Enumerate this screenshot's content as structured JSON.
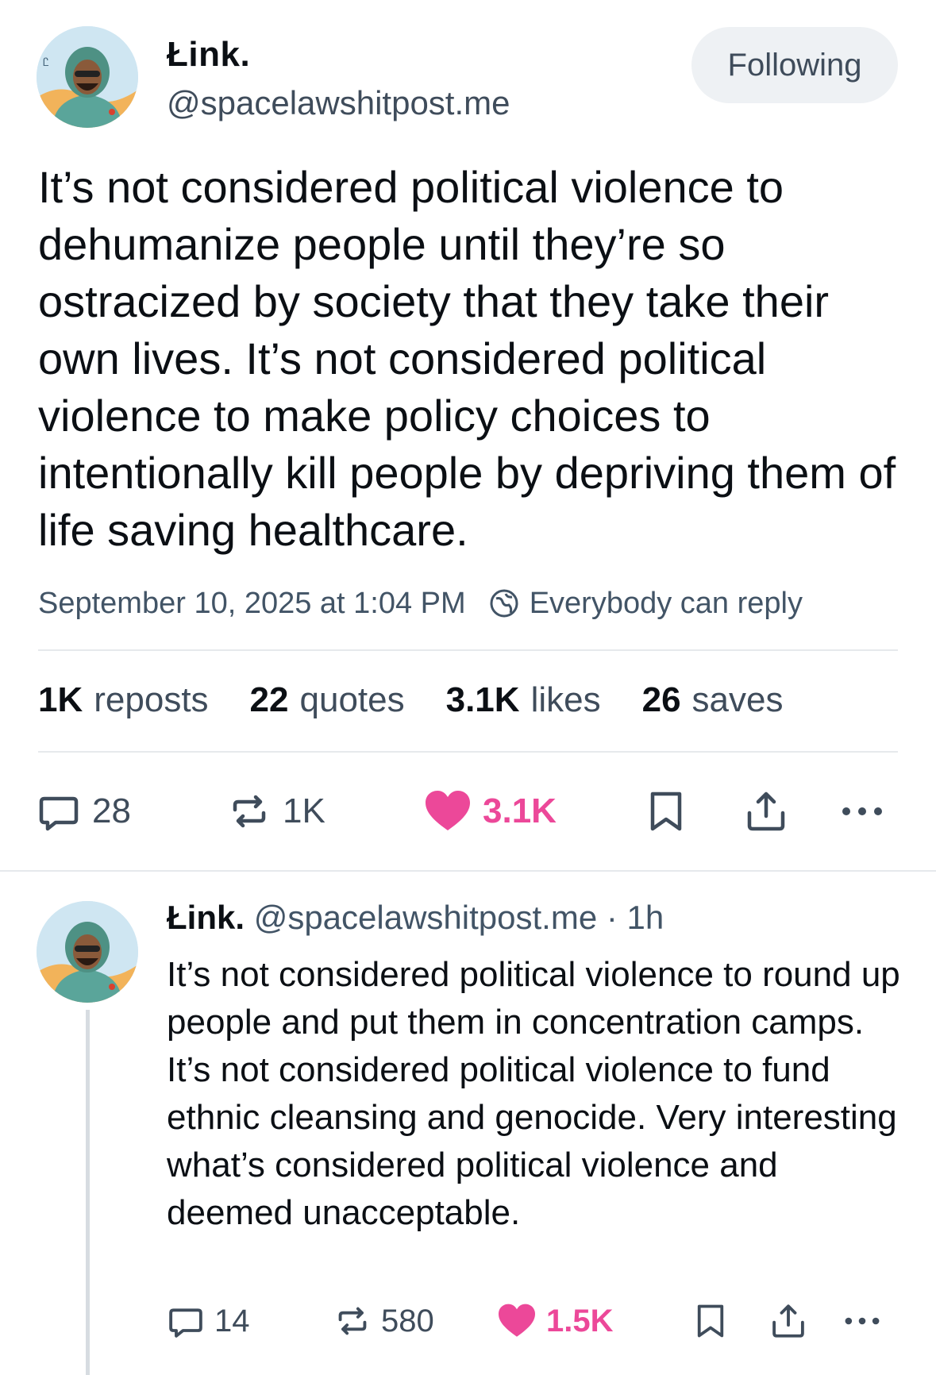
{
  "main_post": {
    "author_name": "Łink.",
    "author_handle": "@spacelawshitpost.me",
    "follow_button_label": "Following",
    "text": "It’s not considered political violence to dehumanize people until they’re so ostracized by society that they take their own lives. It’s not considered political violence to make policy choices to intentionally kill people by depriving them of life saving healthcare.",
    "timestamp": "September 10, 2025 at 1:04 PM",
    "reply_setting": "Everybody can reply",
    "stats": {
      "reposts": {
        "count": "1K",
        "label": "reposts"
      },
      "quotes": {
        "count": "22",
        "label": "quotes"
      },
      "likes": {
        "count": "3.1K",
        "label": "likes"
      },
      "saves": {
        "count": "26",
        "label": "saves"
      }
    },
    "actions": {
      "replies": "28",
      "reposts": "1K",
      "likes": "3.1K"
    },
    "icons": [
      "reply-icon",
      "repost-icon",
      "heart-icon",
      "bookmark-icon",
      "share-icon",
      "more-icon",
      "globe-icon"
    ]
  },
  "reply_post": {
    "author_name": "Łink.",
    "author_handle": "@spacelawshitpost.me",
    "separator": "·",
    "time_ago": "1h",
    "text": "It’s not considered political violence to round up people and put them in concentration camps. It’s not considered political violence to fund ethnic cleansing and genocide. Very interesting what’s considered political violence and deemed unacceptable.",
    "actions": {
      "replies": "14",
      "reposts": "580",
      "likes": "1.5K"
    }
  },
  "colors": {
    "like_pink": "#ec4899",
    "muted_text": "#3f4c5b",
    "divider": "#e6e9ec",
    "follow_bg": "#eef1f4"
  }
}
